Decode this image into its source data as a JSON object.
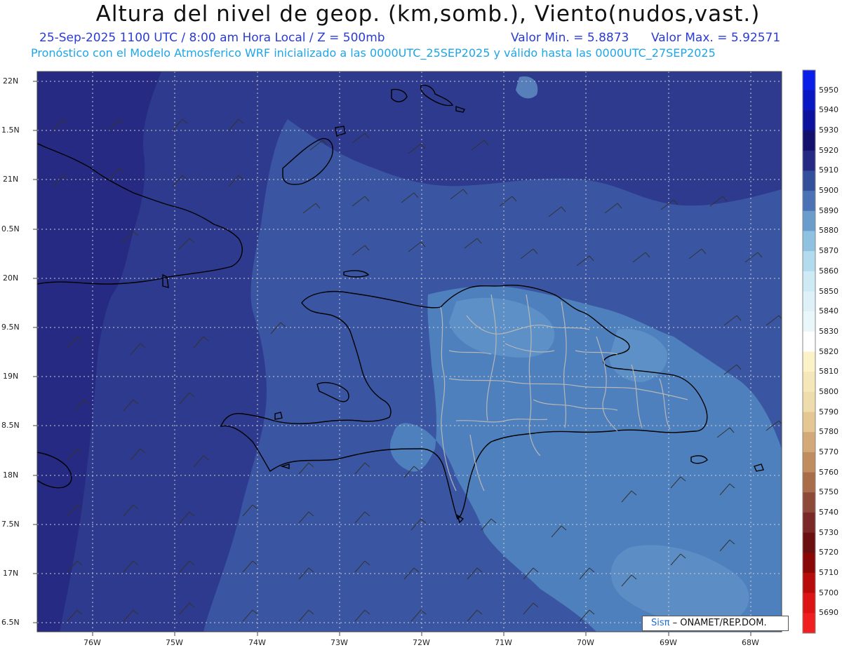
{
  "header": {
    "title": "Altura del nivel de geop. (km,somb.), Viento(nudos,vast.)",
    "line1": "25-Sep-2025  1100 UTC / 8:00 am Hora Local / Z = 500mb",
    "value_min": "Valor Min. = 5.8873",
    "value_max": "Valor Max. = 5.92571",
    "line2": "Pronóstico con el Modelo Atmosferico WRF inicializado a las 0000UTC_25SEP2025 y válido hasta las  0000UTC_27SEP2025"
  },
  "axes": {
    "lat_labels": [
      "22N",
      "1.5N",
      "21N",
      "0.5N",
      "20N",
      "9.5N",
      "19N",
      "8.5N",
      "18N",
      "7.5N",
      "17N",
      "6.5N"
    ],
    "lon_labels": [
      "76W",
      "75W",
      "74W",
      "73W",
      "72W",
      "71W",
      "70W",
      "69W",
      "68W"
    ]
  },
  "colorbar": {
    "levels": [
      "5950",
      "5940",
      "5930",
      "5920",
      "5910",
      "5900",
      "5890",
      "5880",
      "5870",
      "5860",
      "5850",
      "5840",
      "5830",
      "5820",
      "5810",
      "5800",
      "5790",
      "5780",
      "5770",
      "5760",
      "5750",
      "5740",
      "5730",
      "5720",
      "5710",
      "5700",
      "5690"
    ],
    "colors": [
      "#0b1de8",
      "#0a18c4",
      "#0c129e",
      "#14106e",
      "#262a82",
      "#34509a",
      "#4a72b4",
      "#6a9ccc",
      "#8ec2e0",
      "#b2dcee",
      "#cdeaf5",
      "#def1f8",
      "#e9f7fb",
      "#ffffff",
      "#fbf2c8",
      "#f5e7b8",
      "#efdcac",
      "#e5c794",
      "#d3a97a",
      "#c08d5e",
      "#a96d4a",
      "#8e4a38",
      "#7a2828",
      "#6a1010",
      "#8a0808",
      "#b80c0c",
      "#dd1414",
      "#f02020"
    ]
  },
  "map": {
    "field_colors": {
      "deep": "#262a82",
      "dark": "#2e3a8e",
      "mid": "#3a56a2",
      "light": "#4f80be",
      "pale": "#6a9ccc"
    },
    "coastline_color": "#000000",
    "province_color": "#b6b6b6",
    "grid_color": "#cfcfcf"
  },
  "credit": {
    "sis": "Sisπ",
    "rest": "– ONAMET/REP.DOM."
  }
}
